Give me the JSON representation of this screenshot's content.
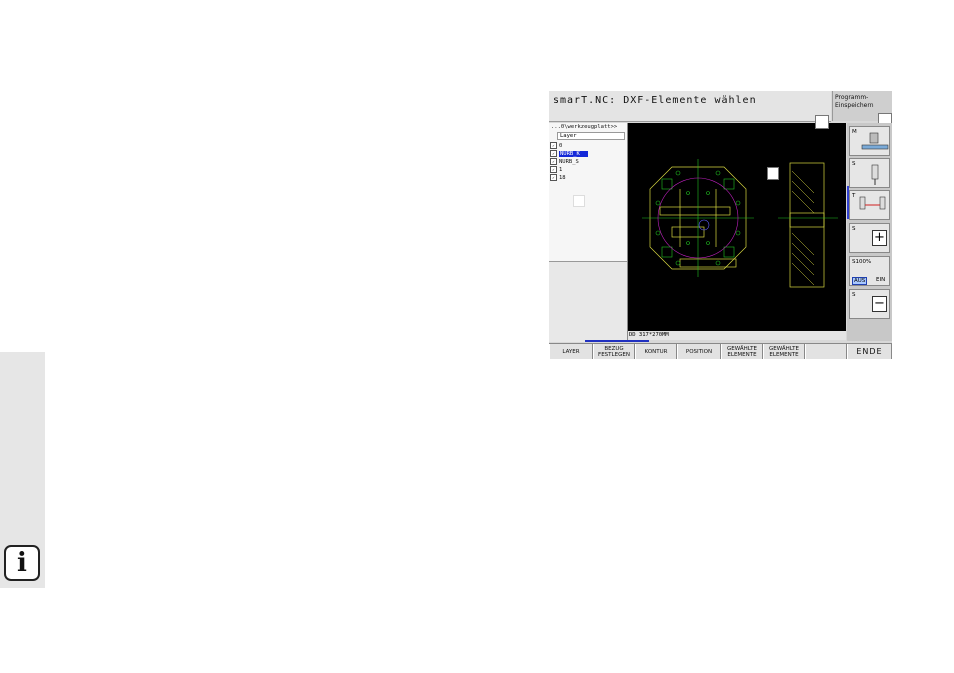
{
  "app": {
    "title": "smarT.NC: DXF-Elemente wählen",
    "program_button_line1": "Programm-",
    "program_button_line2": "Einspeichern"
  },
  "layer_panel": {
    "path": "...0\\werkzeugplatt>>",
    "header": "Layer",
    "layers": [
      {
        "name": "0",
        "checked": true,
        "selected": false
      },
      {
        "name": "NURB_K",
        "checked": true,
        "selected": true
      },
      {
        "name": "NURB_S",
        "checked": true,
        "selected": false
      },
      {
        "name": "1",
        "checked": true,
        "selected": false
      },
      {
        "name": "18",
        "checked": true,
        "selected": false
      }
    ]
  },
  "status": {
    "coord_readout": "DD  317*270MM"
  },
  "right_panel": {
    "m_label": "M",
    "s_label": "S",
    "t_label": "T",
    "s_plus_label": "S",
    "s100_label": "S100%",
    "aus_label": "AUS",
    "ein_label": "EIN",
    "s_minus_label": "S",
    "plus_sign": "+",
    "minus_sign": "−"
  },
  "softkeys": [
    {
      "line1": "LAYER",
      "line2": ""
    },
    {
      "line1": "BEZUG",
      "line2": "FESTLEGEN"
    },
    {
      "line1": "KONTUR",
      "line2": ""
    },
    {
      "line1": "POSITION",
      "line2": ""
    },
    {
      "line1": "GEWÄHLTE",
      "line2": "ELEMENTE"
    },
    {
      "line1": "GEWÄHLTE",
      "line2": "ELEMENTE"
    },
    {
      "line1": "",
      "line2": ""
    },
    {
      "line1": "ENDE",
      "line2": ""
    }
  ],
  "info_icon": "i",
  "colors": {
    "canvas": "#000000",
    "contour": "#d8d840",
    "drill": "#20c020",
    "circle": "#c020c0",
    "select": "#1428d8"
  }
}
